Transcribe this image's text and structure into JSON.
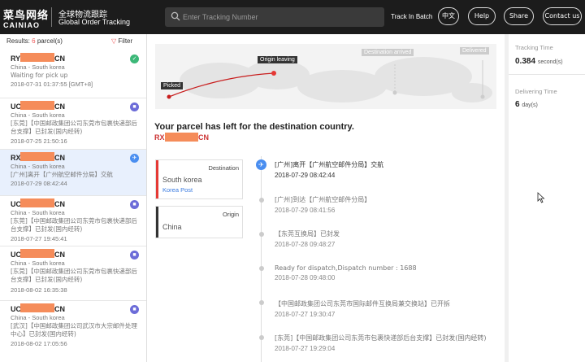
{
  "header": {
    "logo_cn": "菜鸟网络",
    "logo_en": "CAINIAO",
    "subtitle_cn": "全球物流跟踪",
    "subtitle_en": "Global Order Tracking",
    "search_placeholder": "Enter Tracking Number",
    "batch_label": "Track In Batch",
    "lang_label": "中文",
    "help_label": "Help",
    "share_label": "Share",
    "contact_label": "Contact us"
  },
  "results": {
    "label": "Results:",
    "count": "6",
    "unit": "parcel(s)",
    "filter_label": "Filter"
  },
  "parcels": [
    {
      "prefix": "RY",
      "suffix": "CN",
      "route": "China - South korea",
      "status": "Waiting for pick up",
      "date": "2018-07-31 01:37:55 [GMT+8]",
      "status_color": "#3cb878",
      "icon": "check-icon"
    },
    {
      "prefix": "UC",
      "suffix": "CN",
      "route": "China - South korea",
      "status": "[东莞]【中国邮政集团公司东莞市包裹快递部后台支撑】已封发(国内经转)",
      "date": "2018-07-25 21:50:16",
      "status_color": "#6c6cd8",
      "icon": "truck-icon"
    },
    {
      "prefix": "RX",
      "suffix": "CN",
      "route": "China - South korea",
      "status": "[广州]离开【广州航空邮件分局】交航",
      "date": "2018-07-29 08:42:44",
      "status_color": "#4a8ef0",
      "icon": "plane-icon"
    },
    {
      "prefix": "UC",
      "suffix": "CN",
      "route": "China - South korea",
      "status": "[东莞]【中国邮政集团公司东莞市包裹快递部后台支撑】已封发(国内经转)",
      "date": "2018-07-27 19:45:41",
      "status_color": "#6c6cd8",
      "icon": "truck-icon"
    },
    {
      "prefix": "UC",
      "suffix": "CN",
      "route": "China - South korea",
      "status": "[东莞]【中国邮政集团公司东莞市包裹快递部后台支撑】已封发(国内经转)",
      "date": "2018-08-02 16:35:38",
      "status_color": "#6c6cd8",
      "icon": "truck-icon"
    },
    {
      "prefix": "UC",
      "suffix": "CN",
      "route": "China - South korea",
      "status": "[武汉]【中国邮政集团公司武汉市大宗邮件处理中心】已封发(国内经转)",
      "date": "2018-08-02 17:05:56",
      "status_color": "#6c6cd8",
      "icon": "truck-icon"
    }
  ],
  "map": {
    "picked": "Picked",
    "origin_leaving": "Origin leaving",
    "destination_arrived": "Destination arrived",
    "delivered": "Delivered"
  },
  "detail": {
    "headline": "Your parcel has left for the destination country.",
    "prefix": "RX",
    "suffix": "CN",
    "destination_label": "Destination",
    "destination": "South korea",
    "carrier": "Korea Post",
    "origin_label": "Origin",
    "origin": "China"
  },
  "events": [
    {
      "text": "[广州]离开【广州航空邮件分局】交航",
      "date": "2018-07-29 08:42:44"
    },
    {
      "text": "[广州]到达【广州航空邮件分局】",
      "date": "2018-07-29 08:41:56"
    },
    {
      "text": "【东莞互换局】已封发",
      "date": "2018-07-28 09:48:27"
    },
    {
      "text": "Ready for dispatch,Dispatch number : 1688",
      "date": "2018-07-28 09:48:00"
    },
    {
      "text": "【中国邮政集团公司东莞市国际邮件互换局兼交换站】已开拆",
      "date": "2018-07-27 19:30:47"
    },
    {
      "text": "[东莞]【中国邮政集团公司东莞市包裹快递部后台支撑】已封发(国内经转)",
      "date": "2018-07-27 19:29:04"
    }
  ],
  "stats": {
    "tracking_label": "Tracking Time",
    "tracking_value": "0.384",
    "tracking_unit": "second(s)",
    "delivering_label": "Delivering Time",
    "delivering_value": "6",
    "delivering_unit": "day(s)"
  },
  "colors": {
    "accent": "#e55353",
    "mask": "#f58c5a",
    "topbar": "#1c1c1c"
  }
}
